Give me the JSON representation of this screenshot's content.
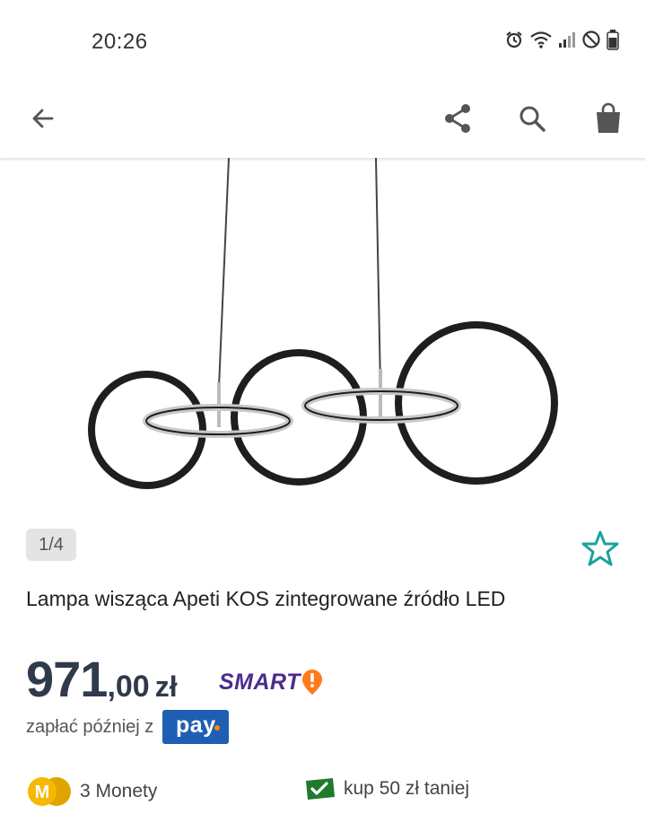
{
  "status": {
    "time": "20:26"
  },
  "toolbar": {
    "back_icon": "arrow-left-icon",
    "share_icon": "share-icon",
    "search_icon": "search-icon",
    "cart_icon": "shopping-bag-icon"
  },
  "product": {
    "image_counter": "1/4",
    "title": "Lampa wisząca Apeti KOS zintegrowane źródło LED",
    "price_int": "971",
    "price_frac": ",00",
    "currency": "zł",
    "smart_label": "SMART",
    "pay_later_text": "zapłać później z",
    "pay_label": "pay",
    "coins_text": "3 Monety",
    "coins_letter": "M",
    "discount_text": "kup 50 zł taniej"
  },
  "colors": {
    "accent_teal": "#1aa39a",
    "price": "#2f3a4a",
    "smart_purple": "#4a2c8f",
    "smart_orange": "#ff7a1a",
    "pay_blue": "#1f5fb3",
    "coin_yellow": "#f6b800",
    "discount_green": "#1f7a2e"
  }
}
